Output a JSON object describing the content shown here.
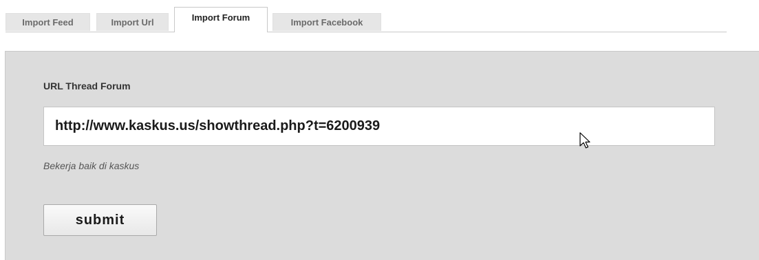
{
  "tabs": [
    {
      "label": "Import Feed",
      "active": false
    },
    {
      "label": "Import Url",
      "active": false
    },
    {
      "label": "Import Forum",
      "active": true
    },
    {
      "label": "Import Facebook",
      "active": false
    }
  ],
  "form": {
    "field_label": "URL Thread Forum",
    "url_value": "http://www.kaskus.us/showthread.php?t=6200939",
    "hint": "Bekerja baik di kaskus",
    "submit_label": "submit"
  },
  "colors": {
    "panel_bg": "#dcdcdc",
    "tab_inactive_bg": "#e6e6e6",
    "tab_active_bg": "#ffffff"
  },
  "icons": {
    "cursor": "mouse-pointer-icon"
  }
}
